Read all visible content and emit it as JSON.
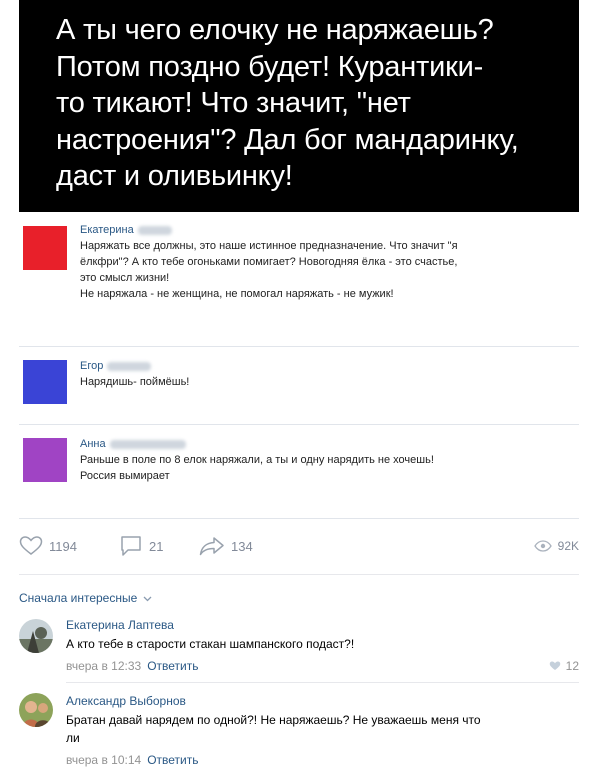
{
  "quote": {
    "lines": [
      "А ты чего елочку не наряжаешь?",
      "Потом поздно будет! Курантики-",
      "то тикают! Что значит, \"нет",
      "настроения\"? Дал бог мандаринку,",
      "даст и оливьинку!"
    ]
  },
  "comments": [
    {
      "name": "Екатерина",
      "avatar_color": "#e8202a",
      "lines": [
        "Наряжать все должны, это наше истинное предназначение. Что значит \"я",
        "ёлкфри\"? А кто тебе огоньками помигает? Новогодняя ёлка - это счастье,",
        "это смысл жизни!",
        "Не наряжала - не женщина, не помогал наряжать - не мужик!"
      ]
    },
    {
      "name": "Егор",
      "avatar_color": "#3a44d6",
      "lines": [
        "Нарядишь- поймёшь!"
      ]
    },
    {
      "name": "Анна",
      "avatar_color": "#a044c4",
      "lines": [
        "Раньше в поле по 8 елок наряжали, а ты и одну нарядить не хочешь!",
        "Россия вымирает"
      ]
    }
  ],
  "stats": {
    "likes": "1194",
    "comments": "21",
    "shares": "134",
    "views": "92K"
  },
  "sort_label": "Сначала интересные",
  "replies": [
    {
      "name": "Екатерина Лаптева",
      "text_lines": [
        "А кто тебе в старости стакан шампанского подаст?!"
      ],
      "time": "вчера в 12:33",
      "reply": "Ответить",
      "likes": "12"
    },
    {
      "name": "Александр Выборнов",
      "text_lines": [
        "Братан давай нарядем по одной?! Не наряжаешь? Не уважаешь меня что",
        "ли"
      ],
      "time": "вчера в 10:14",
      "reply": "Ответить"
    }
  ],
  "colors": {
    "link": "#2a5885",
    "muted": "#828a99",
    "accent_like": "#828a99"
  }
}
